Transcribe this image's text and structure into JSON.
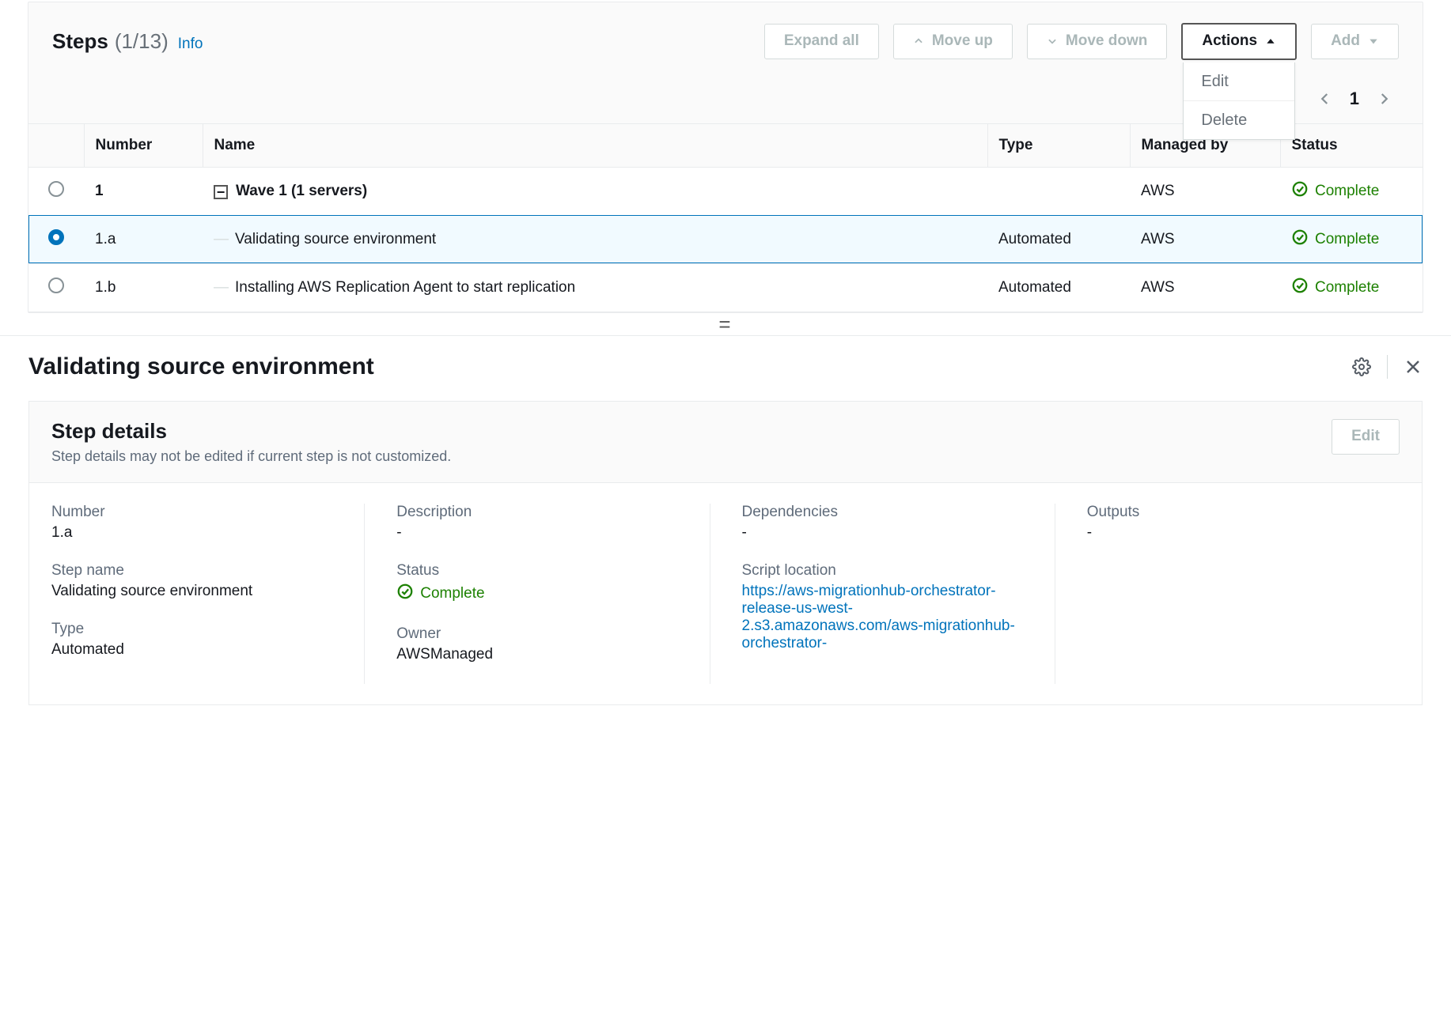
{
  "header": {
    "title": "Steps",
    "count": "(1/13)",
    "info": "Info",
    "expand_all": "Expand all",
    "move_up": "Move up",
    "move_down": "Move down",
    "actions": "Actions",
    "add": "Add",
    "actions_menu": {
      "edit": "Edit",
      "delete": "Delete"
    },
    "page": "1"
  },
  "table": {
    "cols": {
      "number": "Number",
      "name": "Name",
      "type": "Type",
      "managed": "Managed by",
      "status": "Status"
    },
    "rows": [
      {
        "number": "1",
        "name": "Wave 1 (1 servers)",
        "type": "",
        "managed": "AWS",
        "status": "Complete",
        "group": true,
        "selected": false
      },
      {
        "number": "1.a",
        "name": "Validating source environment",
        "type": "Automated",
        "managed": "AWS",
        "status": "Complete",
        "group": false,
        "selected": true
      },
      {
        "number": "1.b",
        "name": "Installing AWS Replication Agent to start replication",
        "type": "Automated",
        "managed": "AWS",
        "status": "Complete",
        "group": false,
        "selected": false
      }
    ]
  },
  "detail": {
    "title": "Validating source environment",
    "panel_title": "Step details",
    "panel_sub": "Step details may not be edited if current step is not customized.",
    "edit": "Edit",
    "fields": {
      "number_label": "Number",
      "number_value": "1.a",
      "stepname_label": "Step name",
      "stepname_value": "Validating source environment",
      "type_label": "Type",
      "type_value": "Automated",
      "desc_label": "Description",
      "desc_value": "-",
      "status_label": "Status",
      "status_value": "Complete",
      "owner_label": "Owner",
      "owner_value": "AWSManaged",
      "deps_label": "Dependencies",
      "deps_value": "-",
      "script_label": "Script location",
      "script_value": "https://aws-migrationhub-orchestrator-release-us-west-2.s3.amazonaws.com/aws-migrationhub-orchestrator-",
      "outputs_label": "Outputs",
      "outputs_value": "-"
    }
  }
}
